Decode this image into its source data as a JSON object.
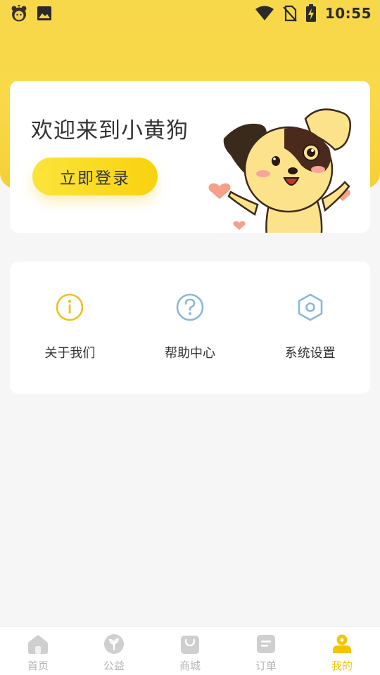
{
  "status_bar": {
    "time": "10:55",
    "left_icons": [
      "bear-app-icon",
      "image-icon"
    ],
    "right_icons": [
      "wifi-icon",
      "no-sim-icon",
      "battery-charging-icon"
    ]
  },
  "welcome": {
    "title": "欢迎来到小黄狗",
    "login_label": "立即登录",
    "illustration": "puppy-icon"
  },
  "menu": {
    "items": [
      {
        "label": "关于我们",
        "icon": "info-icon",
        "color": "#f0c020"
      },
      {
        "label": "帮助中心",
        "icon": "question-icon",
        "color": "#8ab6dc"
      },
      {
        "label": "系统设置",
        "icon": "settings-hex-icon",
        "color": "#8ab6dc"
      }
    ]
  },
  "bottom_nav": {
    "items": [
      {
        "label": "首页",
        "icon": "home-icon",
        "active": false
      },
      {
        "label": "公益",
        "icon": "charity-leaf-icon",
        "active": false
      },
      {
        "label": "商城",
        "icon": "shopping-bag-icon",
        "active": false
      },
      {
        "label": "订单",
        "icon": "order-list-icon",
        "active": false
      },
      {
        "label": "我的",
        "icon": "profile-icon",
        "active": true
      }
    ],
    "active_color": "#f5c400",
    "inactive_color": "#cfcfcf"
  },
  "theme": {
    "header_yellow": "#f8d645",
    "button_yellow": "#fad51c"
  }
}
